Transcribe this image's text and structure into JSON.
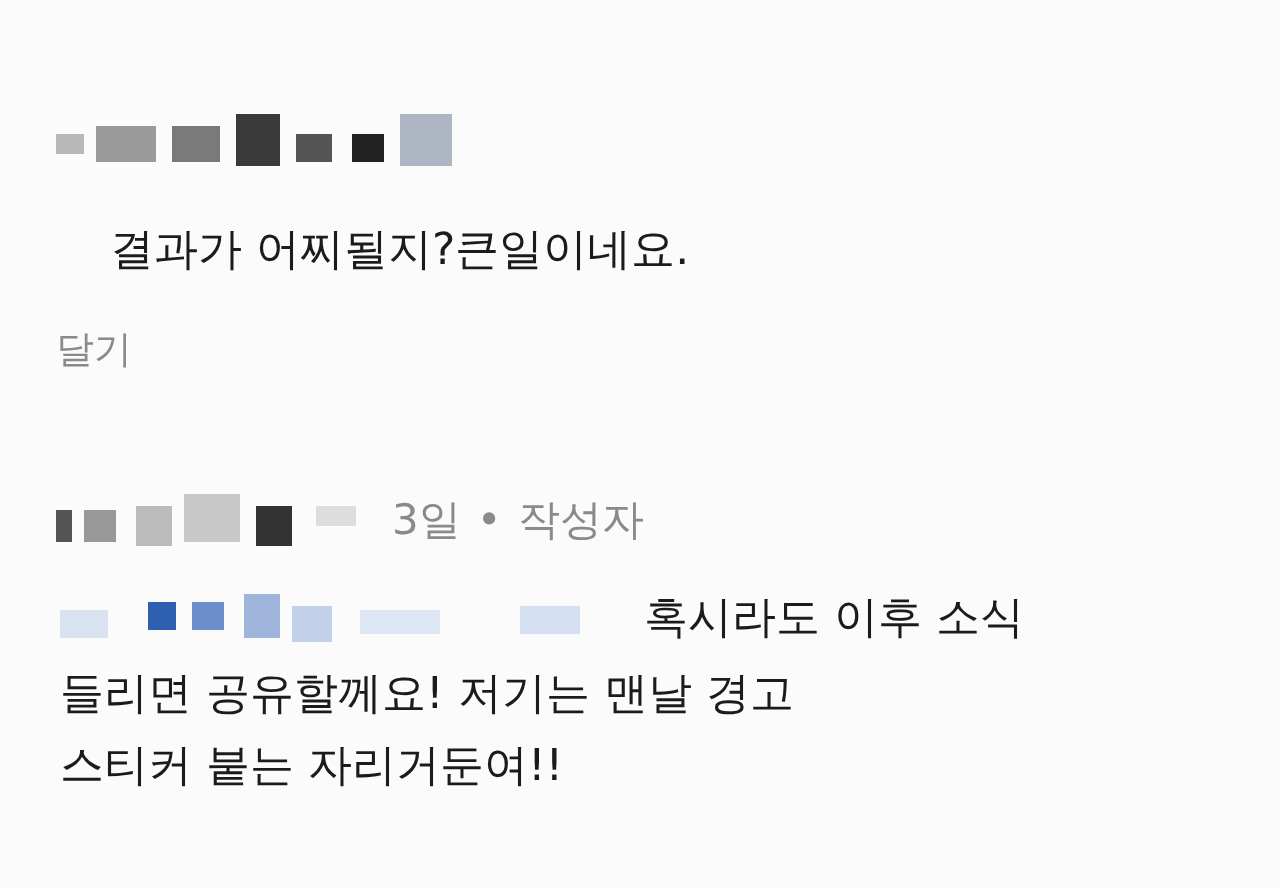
{
  "comments": [
    {
      "text_lines": [
        "결과가 어찌될지?큰일이네요."
      ],
      "action": "달기"
    },
    {
      "time": "3일",
      "separator": "•",
      "badge": "작성자",
      "text_lines": [
        "혹시라도 이후 소식",
        "들리면 공유할께요! 저기는 맨날 경고",
        "스티커 붙는 자리거둔여!!"
      ]
    }
  ]
}
